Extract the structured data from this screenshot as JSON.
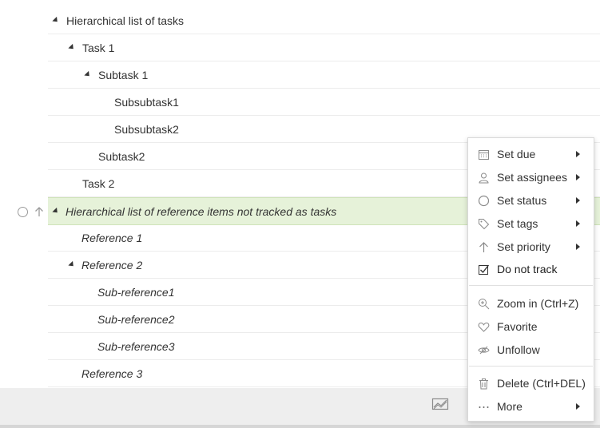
{
  "tree": {
    "rows": [
      {
        "label": "Hierarchical list of tasks"
      },
      {
        "label": "Task 1"
      },
      {
        "label": "Subtask 1"
      },
      {
        "label": "Subsubtask1"
      },
      {
        "label": "Subsubtask2"
      },
      {
        "label": "Subtask2"
      },
      {
        "label": "Task 2"
      },
      {
        "label": "Hierarchical list of reference items not tracked as tasks"
      },
      {
        "label": "Reference 1"
      },
      {
        "label": "Reference 2"
      },
      {
        "label": "Sub-reference1"
      },
      {
        "label": "Sub-reference2"
      },
      {
        "label": "Sub-reference3"
      },
      {
        "label": "Reference 3"
      }
    ]
  },
  "context_menu": {
    "items": [
      {
        "label": "Set due",
        "icon": "calendar-icon",
        "submenu": true
      },
      {
        "label": "Set assignees",
        "icon": "person-icon",
        "submenu": true
      },
      {
        "label": "Set status",
        "icon": "circle-icon",
        "submenu": true
      },
      {
        "label": "Set tags",
        "icon": "tag-icon",
        "submenu": true
      },
      {
        "label": "Set priority",
        "icon": "arrow-up-icon",
        "submenu": true
      },
      {
        "label": "Do not track",
        "icon": "checkbox-checked-icon",
        "submenu": false
      },
      {
        "label": "Zoom in (Ctrl+Z)",
        "icon": "zoom-in-icon",
        "submenu": false
      },
      {
        "label": "Favorite",
        "icon": "heart-icon",
        "submenu": false
      },
      {
        "label": "Unfollow",
        "icon": "eye-off-icon",
        "submenu": false
      },
      {
        "label": "Delete (Ctrl+DEL)",
        "icon": "trash-icon",
        "submenu": false
      },
      {
        "label": "More",
        "icon": "ellipsis-icon",
        "submenu": true
      }
    ]
  },
  "colors": {
    "selected_row_bg": "#e6f2d9",
    "bottom_bar_bg": "#eeeeee"
  }
}
